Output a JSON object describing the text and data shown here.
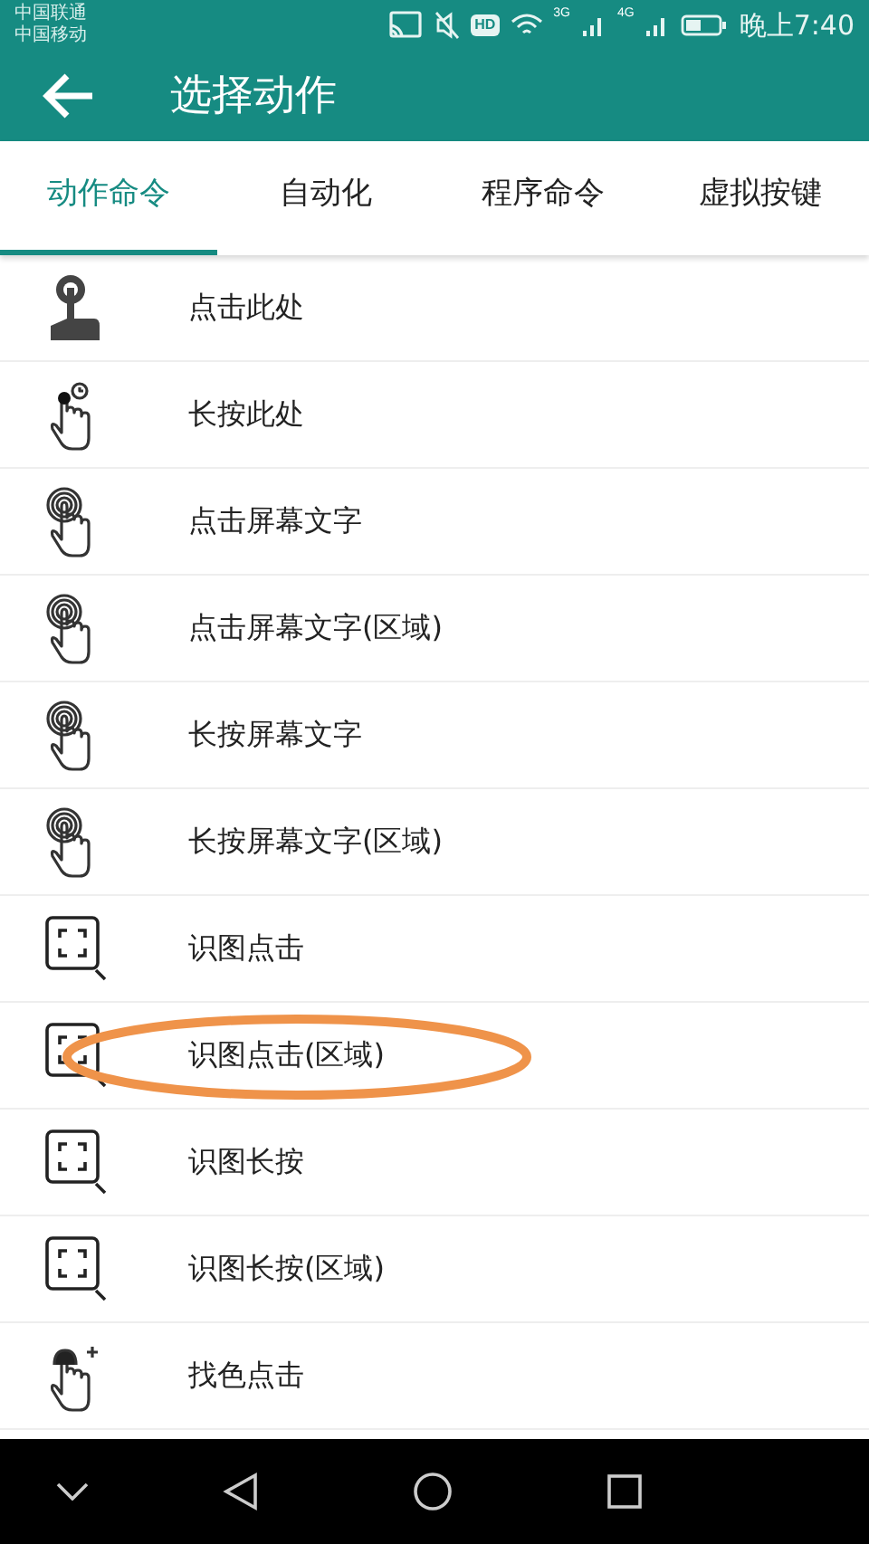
{
  "status_bar": {
    "carriers": [
      "中国联通",
      "中国移动"
    ],
    "hd": "HD",
    "net1": "3G",
    "net2": "4G",
    "time": "晚上7:40"
  },
  "app_bar": {
    "title": "选择动作"
  },
  "tabs": [
    {
      "label": "动作命令",
      "selected": true
    },
    {
      "label": "自动化",
      "selected": false
    },
    {
      "label": "程序命令",
      "selected": false
    },
    {
      "label": "虚拟按键",
      "selected": false
    }
  ],
  "actions": [
    {
      "label": "点击此处",
      "kind": "tap",
      "circled": false
    },
    {
      "label": "长按此处",
      "kind": "hold",
      "circled": false
    },
    {
      "label": "点击屏幕文字",
      "kind": "touch",
      "circled": false
    },
    {
      "label": "点击屏幕文字(区域)",
      "kind": "touch",
      "circled": false
    },
    {
      "label": "长按屏幕文字",
      "kind": "touch",
      "circled": false
    },
    {
      "label": "长按屏幕文字(区域)",
      "kind": "touch",
      "circled": false
    },
    {
      "label": "识图点击",
      "kind": "image",
      "circled": false
    },
    {
      "label": "识图点击(区域)",
      "kind": "image",
      "circled": true
    },
    {
      "label": "识图长按",
      "kind": "image",
      "circled": false
    },
    {
      "label": "识图长按(区域)",
      "kind": "image",
      "circled": false
    },
    {
      "label": "找色点击",
      "kind": "color",
      "circled": false
    }
  ]
}
